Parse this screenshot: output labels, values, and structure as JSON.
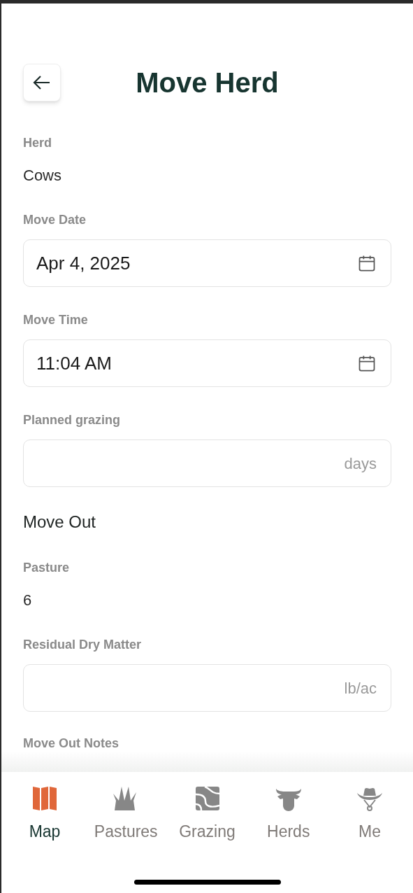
{
  "header": {
    "title": "Move Herd"
  },
  "fields": [
    {
      "kind": "text",
      "label": "Herd",
      "value": "Cows"
    },
    {
      "kind": "date",
      "label": "Move Date",
      "value": "Apr 4, 2025"
    },
    {
      "kind": "date",
      "label": "Move Time",
      "value": "11:04 AM"
    },
    {
      "kind": "unit",
      "label": "Planned grazing",
      "unit": "days"
    },
    {
      "kind": "heading",
      "label": "Move Out"
    },
    {
      "kind": "text",
      "label": "Pasture",
      "value": "6"
    },
    {
      "kind": "unit",
      "label": "Residual Dry Matter",
      "unit": "lb/ac"
    },
    {
      "kind": "label",
      "label": "Move Out Notes"
    }
  ],
  "tabs": [
    {
      "label": "Map",
      "selected": true
    },
    {
      "label": "Pastures",
      "selected": false
    },
    {
      "label": "Grazing",
      "selected": false
    },
    {
      "label": "Herds",
      "selected": false
    },
    {
      "label": "Me",
      "selected": false
    }
  ]
}
